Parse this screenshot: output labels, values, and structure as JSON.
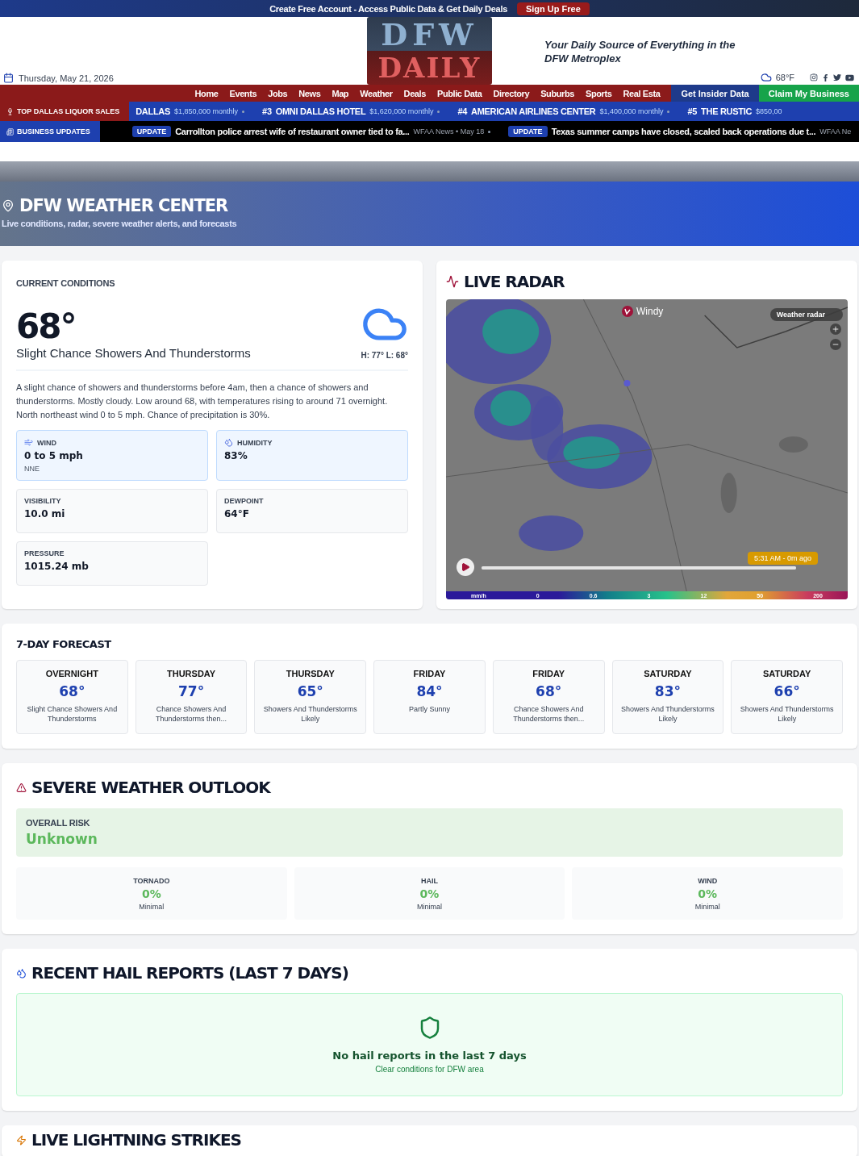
{
  "promo_bar": {
    "text": "Create Free Account - Access Public Data & Get Daily Deals",
    "button": "Sign Up Free"
  },
  "header": {
    "date": "Thursday, May 21, 2026",
    "logo_top": "DFW",
    "logo_bottom": "DAILY",
    "tagline": "Your Daily Source of Everything in the DFW Metroplex",
    "temperature": "68°F"
  },
  "nav": {
    "items": [
      "Home",
      "Events",
      "Jobs",
      "News",
      "Map",
      "Weather",
      "Deals",
      "Public Data",
      "Directory",
      "Suburbs",
      "Sports",
      "Real Esta"
    ],
    "insider_button": "Get Insider Data",
    "claim_button": "Claim My Business"
  },
  "liquor_ticker": {
    "label": "TOP DALLAS LIQUOR SALES",
    "items": [
      {
        "name": "DALLAS",
        "amount": "$1,850,000 monthly"
      },
      {
        "rank": "#3",
        "name": "OMNI DALLAS HOTEL",
        "amount": "$1,620,000 monthly"
      },
      {
        "rank": "#4",
        "name": "AMERICAN AIRLINES CENTER",
        "amount": "$1,400,000 monthly"
      },
      {
        "rank": "#5",
        "name": "THE RUSTIC",
        "amount": "$850,00"
      }
    ]
  },
  "updates_ticker": {
    "label": "BUSINESS UPDATES",
    "items": [
      {
        "badge": "UPDATE",
        "headline": "Carrollton police arrest wife of restaurant owner tied to fa...",
        "source": "WFAA News • May 18"
      },
      {
        "badge": "UPDATE",
        "headline": "Texas summer camps have closed, scaled back operations due t...",
        "source": "WFAA Ne"
      }
    ]
  },
  "hero": {
    "title": "DFW WEATHER CENTER",
    "subtitle": "Live conditions, radar, severe weather alerts, and forecasts"
  },
  "current": {
    "heading": "CURRENT CONDITIONS",
    "temperature": "68°",
    "condition": "Slight Chance Showers And Thunderstorms",
    "high_low": "H: 77° L: 68°",
    "description": "A slight chance of showers and thunderstorms before 4am, then a chance of showers and thunderstorms. Mostly cloudy. Low around 68, with temperatures rising to around 71 overnight. North northeast wind 0 to 5 mph. Chance of precipitation is 30%.",
    "stats": [
      {
        "kind": "wind",
        "label": "WIND",
        "value": "0 to 5 mph",
        "sub": "NNE",
        "highlighted": true
      },
      {
        "kind": "humidity",
        "label": "HUMIDITY",
        "value": "83%",
        "highlighted": true
      },
      {
        "kind": "plain",
        "label": "VISIBILITY",
        "value": "10.0 mi",
        "highlighted": false
      },
      {
        "kind": "plain",
        "label": "DEWPOINT",
        "value": "64°F",
        "highlighted": false
      },
      {
        "kind": "plain",
        "label": "PRESSURE",
        "value": "1015.24 mb",
        "highlighted": false
      }
    ]
  },
  "radar": {
    "heading": "LIVE RADAR",
    "brand": "Windy",
    "mode": "Weather radar",
    "time": "5:31 AM - 0m ago",
    "timeline": {
      "level": 1
    },
    "legend": [
      "mm/h",
      "0",
      "0.6",
      "3",
      "12",
      "50",
      "200"
    ]
  },
  "forecast": {
    "heading": "7-DAY FORECAST",
    "days": [
      {
        "name": "OVERNIGHT",
        "temp": "68°",
        "summary": "Slight Chance Showers And Thunderstorms"
      },
      {
        "name": "THURSDAY",
        "temp": "77°",
        "summary": "Chance Showers And Thunderstorms then..."
      },
      {
        "name": "THURSDAY",
        "temp": "65°",
        "summary": "Showers And Thunderstorms Likely"
      },
      {
        "name": "FRIDAY",
        "temp": "84°",
        "summary": "Partly Sunny"
      },
      {
        "name": "FRIDAY",
        "temp": "68°",
        "summary": "Chance Showers And Thunderstorms then..."
      },
      {
        "name": "SATURDAY",
        "temp": "83°",
        "summary": "Showers And Thunderstorms Likely"
      },
      {
        "name": "SATURDAY",
        "temp": "66°",
        "summary": "Showers And Thunderstorms Likely"
      }
    ]
  },
  "severe": {
    "heading": "SEVERE WEATHER OUTLOOK",
    "overall_label": "OVERALL RISK",
    "overall_value": "Unknown",
    "risks": [
      {
        "label": "TORNADO",
        "value": "0%",
        "level_text": "Minimal"
      },
      {
        "label": "HAIL",
        "value": "0%",
        "level_text": "Minimal"
      },
      {
        "label": "WIND",
        "value": "0%",
        "level_text": "Minimal"
      }
    ]
  },
  "hail": {
    "heading": "RECENT HAIL REPORTS (LAST 7 DAYS)",
    "message": "No hail reports in the last 7 days",
    "note": "Clear conditions for DFW area"
  },
  "lightning": {
    "heading": "LIVE LIGHTNING STRIKES"
  }
}
